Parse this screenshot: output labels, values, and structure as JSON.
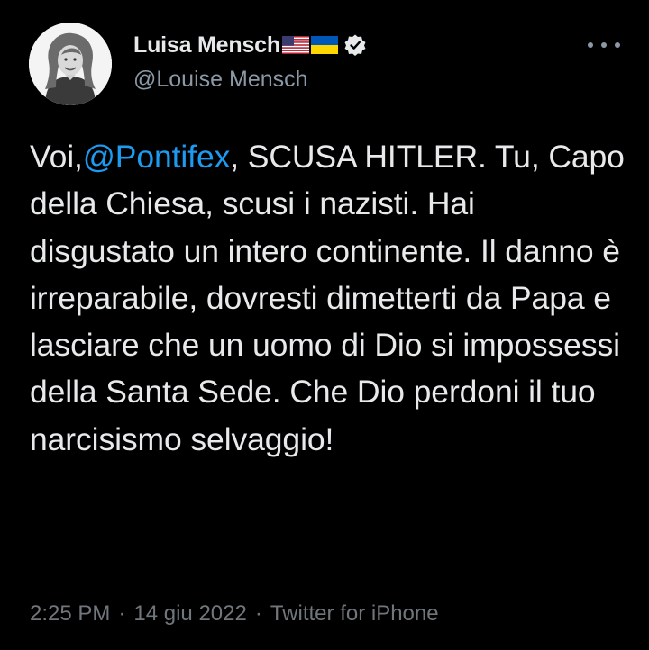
{
  "author": {
    "display_name": "Luisa Mensch",
    "handle": "@Louise Mensch",
    "avatar_icon": "profile-photo-avatar",
    "badges": [
      "us-flag-icon",
      "ukraine-flag-icon",
      "verified-badge-icon"
    ]
  },
  "menu": {
    "more_icon": "more-options-icon"
  },
  "tweet": {
    "text_before": "Voi,",
    "mention": "@Pontifex",
    "text_after": ", SCUSA HITLER. Tu, Capo della Chiesa, scusi i nazisti. Hai disgustato un intero continente. Il danno è irreparabile, dovresti dimetterti da Papa e lasciare che un uomo di Dio si impossessi della Santa Sede. Che Dio perdoni il tuo narcisismo selvaggio!"
  },
  "meta": {
    "time": "2:25 PM",
    "date": "14 giu 2022",
    "separator": "·",
    "source": "Twitter for iPhone"
  },
  "colors": {
    "background": "#000000",
    "text": "#e7e9ea",
    "secondary": "#8b98a5",
    "link": "#1d9bf0"
  }
}
